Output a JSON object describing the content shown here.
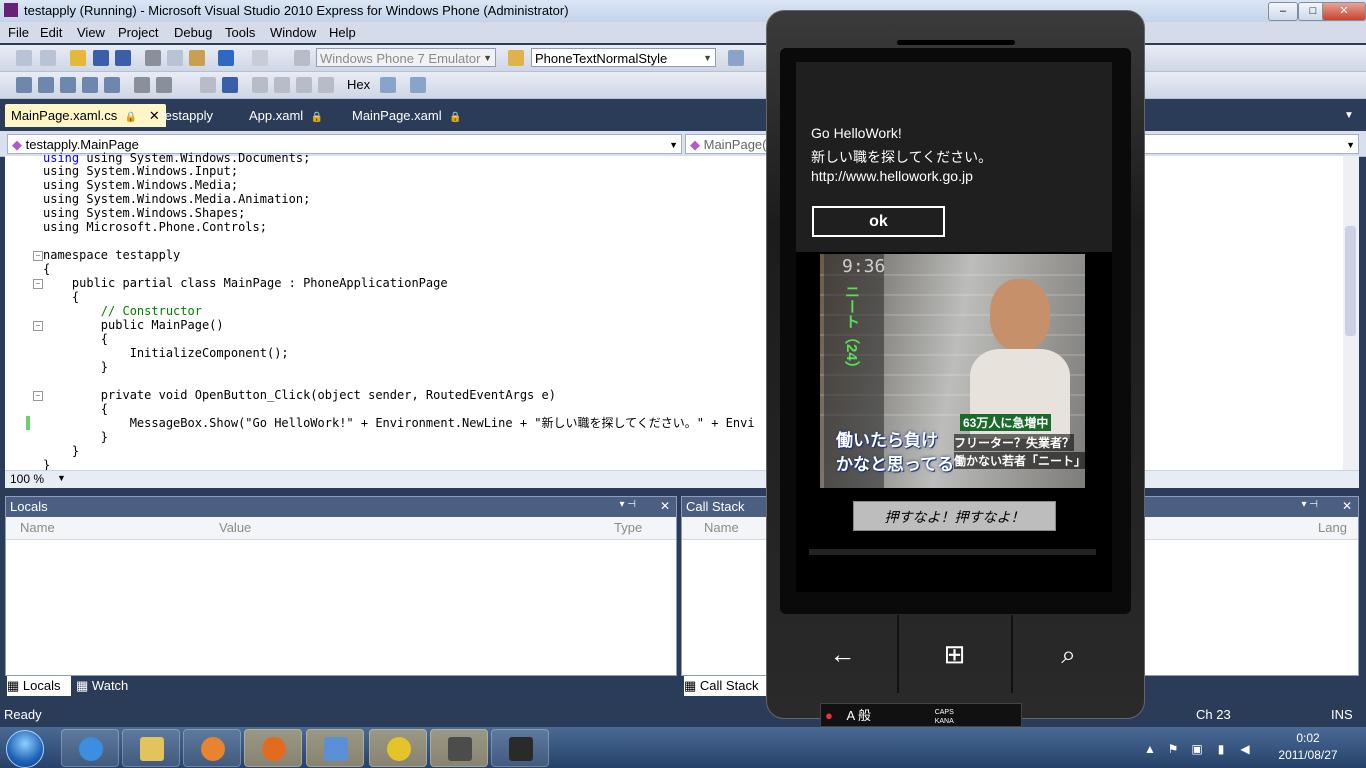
{
  "window": {
    "title": "testapply (Running) - Microsoft Visual Studio 2010 Express for Windows Phone (Administrator)",
    "controls": {
      "minimize": "–",
      "maximize": "□",
      "close": "✕"
    }
  },
  "menu": [
    "File",
    "Edit",
    "View",
    "Project",
    "Debug",
    "Tools",
    "Window",
    "Help"
  ],
  "toolbar": {
    "target_device": "Windows Phone 7 Emulator",
    "style_select": "PhoneTextNormalStyle",
    "hex_label": "Hex"
  },
  "tabs": [
    {
      "label": "MainPage.xaml.cs",
      "active": true,
      "close": "✕"
    },
    {
      "label": "testapply"
    },
    {
      "label": "App.xaml"
    },
    {
      "label": "MainPage.xaml"
    }
  ],
  "editor": {
    "class_dropdown": "testapply.MainPage",
    "member_dropdown": "MainPage(",
    "zoom": "100 %",
    "lines": [
      "using System.Windows.Documents;",
      "using System.Windows.Input;",
      "using System.Windows.Media;",
      "using System.Windows.Media.Animation;",
      "using System.Windows.Shapes;",
      "using Microsoft.Phone.Controls;",
      "",
      "namespace testapply",
      "{",
      "    public partial class MainPage : PhoneApplicationPage",
      "    {",
      "        // Constructor",
      "        public MainPage()",
      "        {",
      "            InitializeComponent();",
      "        }",
      "",
      "        private void OpenButton_Click(object sender, RoutedEventArgs e)",
      "        {",
      "            MessageBox.Show(\"Go HelloWork!\" + Environment.NewLine + \"新しい職を探してください。\" + Envi",
      "        }",
      "    }",
      "}"
    ]
  },
  "locals_panel": {
    "title": "Locals",
    "columns": [
      "Name",
      "Value",
      "Type"
    ],
    "tabs": [
      "Locals",
      "Watch"
    ]
  },
  "callstack_panel": {
    "title": "Call Stack",
    "columns": [
      "Name",
      "Lang"
    ],
    "tab": "Call Stack"
  },
  "status": {
    "left": "Ready",
    "ch": "Ch 23",
    "mode": "INS"
  },
  "phone": {
    "message_lines": [
      "Go HelloWork!",
      "新しい職を探してください。",
      "http://www.hellowork.go.jp"
    ],
    "ok_label": "ok",
    "photo_time": "9:36",
    "photo_caption_1": "63万人に急増中",
    "photo_caption_2": "フリーター？失業者？",
    "photo_caption_3": "働かない若者「ニート」",
    "photo_caption_4": "働いたら負け",
    "photo_caption_5": "かなと思ってる",
    "photo_vertical": "ニート（24）",
    "push_button": "押すなよ！押すなよ！",
    "keys": {
      "back": "←",
      "start": "⊞",
      "search": "⌕"
    }
  },
  "ime": {
    "mode": "A 般",
    "caps": "CAPS",
    "kana": "KANA"
  },
  "taskbar": {
    "clock_time": "0:02",
    "clock_date": "2011/08/27"
  }
}
